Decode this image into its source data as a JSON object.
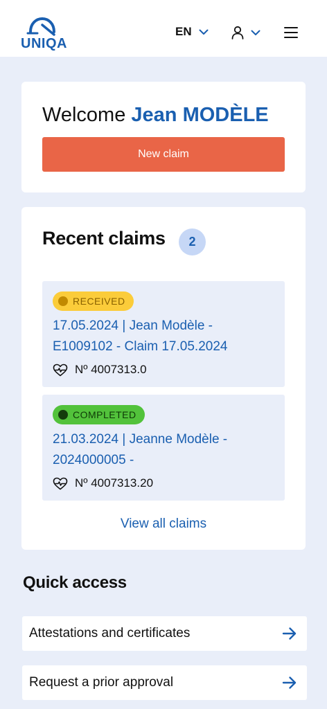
{
  "header": {
    "logo_text": "UNIQA",
    "language": "EN"
  },
  "welcome": {
    "greeting": "Welcome",
    "name": "Jean MODÈLE",
    "new_claim_label": "New claim"
  },
  "recent_claims": {
    "title": "Recent claims",
    "count": "2",
    "items": [
      {
        "status": "RECEIVED",
        "line1": "17.05.2024 | Jean Modèle -",
        "line2": "E1009102 - Claim 17.05.2024",
        "number": "Nº 4007313.0"
      },
      {
        "status": "COMPLETED",
        "line1": "21.03.2024 | Jeanne Modèle -",
        "line2": "2024000005 -",
        "number": "Nº 4007313.20"
      }
    ],
    "view_all_label": "View all claims"
  },
  "quick_access": {
    "title": "Quick access",
    "items": [
      {
        "label": "Attestations and certificates"
      },
      {
        "label": "Request a prior approval"
      }
    ]
  },
  "colors": {
    "brand_blue": "#1A5FB0",
    "accent_orange": "#E96547",
    "received_yellow": "#FBCC3A",
    "completed_green": "#52C23B",
    "background": "#E9EEF9"
  },
  "icons": {
    "logo": "uniqa-logo-icon",
    "user": "user-icon",
    "menu": "hamburger-menu-icon",
    "chevron": "chevron-down-icon",
    "health": "heartbeat-icon",
    "arrow": "arrow-right-icon"
  }
}
